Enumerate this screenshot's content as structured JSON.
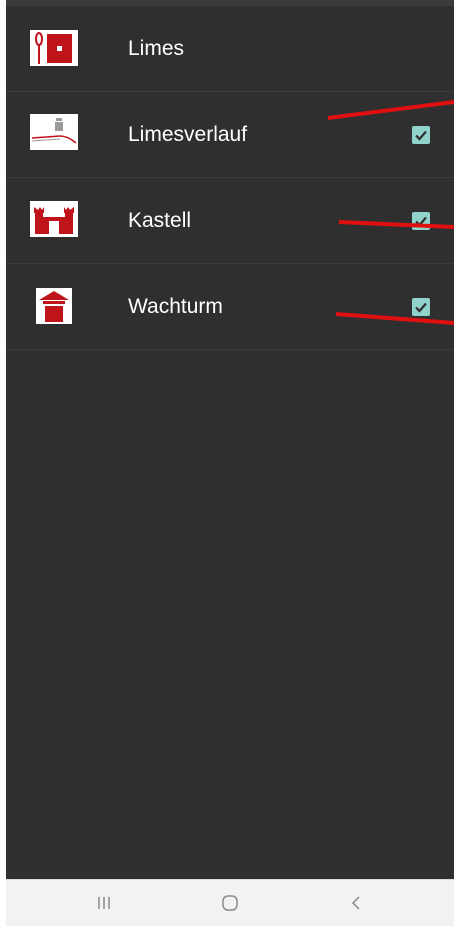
{
  "layers": [
    {
      "label": "Limes",
      "icon": "limes-marker-icon",
      "has_checkbox": false
    },
    {
      "label": "Limesverlauf",
      "icon": "limes-path-tower-icon",
      "has_checkbox": true,
      "checked": true
    },
    {
      "label": "Kastell",
      "icon": "castle-icon",
      "has_checkbox": true,
      "checked": true
    },
    {
      "label": "Wachturm",
      "icon": "watchtower-icon",
      "has_checkbox": true,
      "checked": true
    }
  ],
  "navigation": {
    "recent_icon": "recent-apps-icon",
    "home_icon": "home-icon",
    "back_icon": "back-icon"
  },
  "colors": {
    "background": "#2f2f2f",
    "text": "#ffffff",
    "icon_red": "#c0141b",
    "checkbox": "#8fd3cc",
    "annotation_red": "#e01010",
    "navbar": "#f2f2f2"
  }
}
